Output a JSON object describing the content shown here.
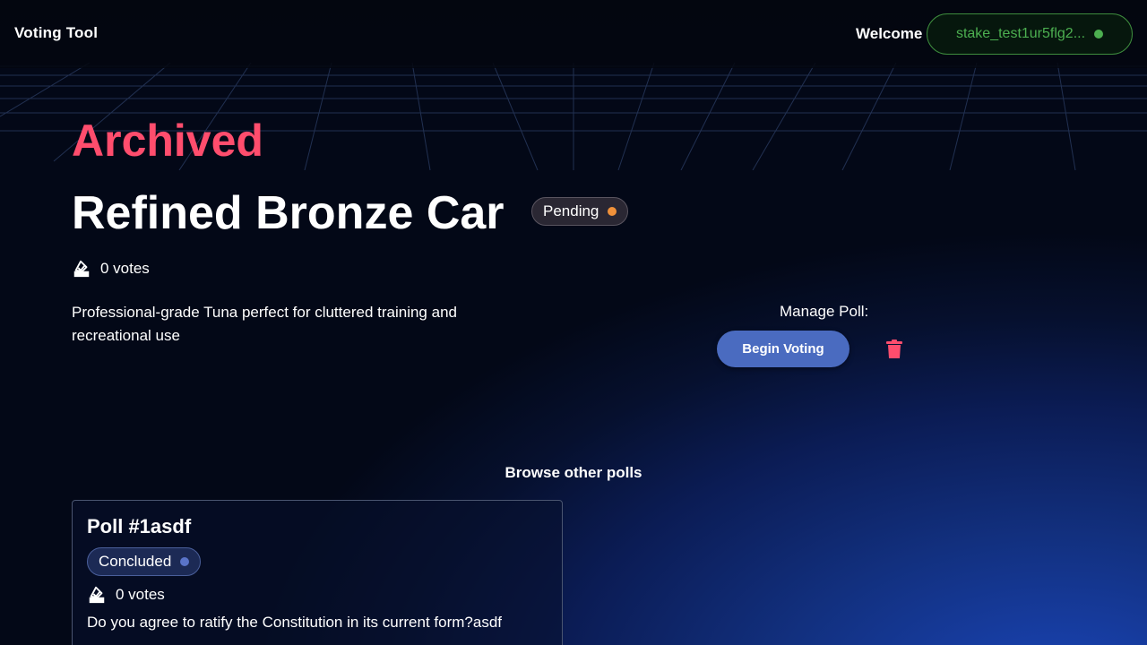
{
  "header": {
    "app_title": "Voting Tool",
    "welcome": "Welcome",
    "wallet_address": "stake_test1ur5flg2...",
    "wallet_status_color": "#4caf50"
  },
  "poll": {
    "status_heading": "Archived",
    "title": "Refined Bronze Car",
    "badge": "Pending",
    "votes": "0 votes",
    "description": "Professional-grade Tuna perfect for cluttered training and recreational use",
    "manage_label": "Manage Poll:",
    "begin_button": "Begin Voting",
    "icons": {
      "votes": "ballot-icon",
      "delete": "trash-icon"
    }
  },
  "browse": {
    "heading": "Browse other polls",
    "cards": [
      {
        "title": "Poll #1asdf",
        "badge": "Concluded",
        "votes": "0 votes",
        "question": "Do you agree to ratify the Constitution in its current form?asdf"
      }
    ]
  },
  "colors": {
    "accent_red": "#ff4d6d",
    "pending": "#f0913a",
    "concluded": "#5a74c8",
    "button": "#4a6bc0"
  }
}
